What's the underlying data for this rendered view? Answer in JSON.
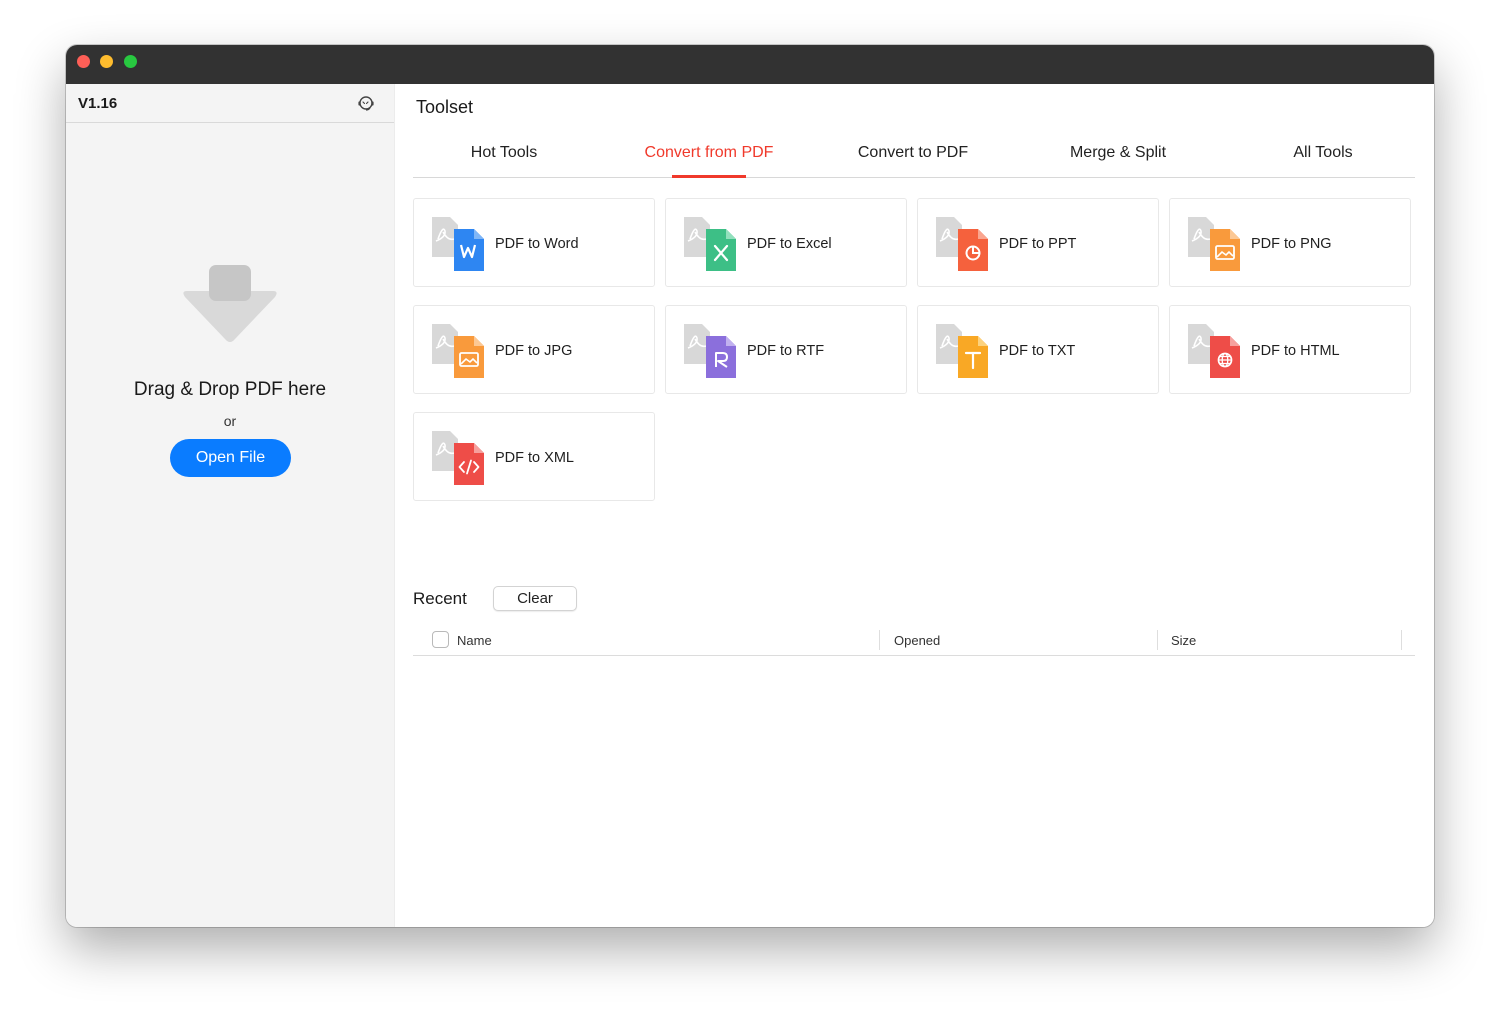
{
  "sidebar": {
    "version": "V1.16",
    "drop_text": "Drag & Drop PDF here",
    "or_text": "or",
    "open_button": "Open File"
  },
  "main": {
    "title": "Toolset",
    "tabs": [
      {
        "label": "Hot Tools",
        "active": false
      },
      {
        "label": "Convert from PDF",
        "active": true
      },
      {
        "label": "Convert to PDF",
        "active": false
      },
      {
        "label": "Merge & Split",
        "active": false
      },
      {
        "label": "All Tools",
        "active": false
      }
    ],
    "tools": [
      {
        "label": "PDF to Word",
        "icon": "word-file-icon",
        "color": "#2e86f2"
      },
      {
        "label": "PDF to Excel",
        "icon": "excel-file-icon",
        "color": "#3dbf86"
      },
      {
        "label": "PDF to PPT",
        "icon": "ppt-file-icon",
        "color": "#f5613d"
      },
      {
        "label": "PDF to PNG",
        "icon": "png-file-icon",
        "color": "#f99a3c"
      },
      {
        "label": "PDF to JPG",
        "icon": "jpg-file-icon",
        "color": "#f99a3c"
      },
      {
        "label": "PDF to RTF",
        "icon": "rtf-file-icon",
        "color": "#8b6fdc"
      },
      {
        "label": "PDF to TXT",
        "icon": "txt-file-icon",
        "color": "#f9a825"
      },
      {
        "label": "PDF to HTML",
        "icon": "html-file-icon",
        "color": "#ee4d48"
      },
      {
        "label": "PDF to XML",
        "icon": "xml-file-icon",
        "color": "#ee4d48"
      }
    ]
  },
  "recent": {
    "title": "Recent",
    "clear_button": "Clear",
    "columns": [
      "Name",
      "Opened",
      "Size"
    ]
  },
  "colors": {
    "accent": "#f0392b",
    "primary_button": "#0a7cff"
  }
}
